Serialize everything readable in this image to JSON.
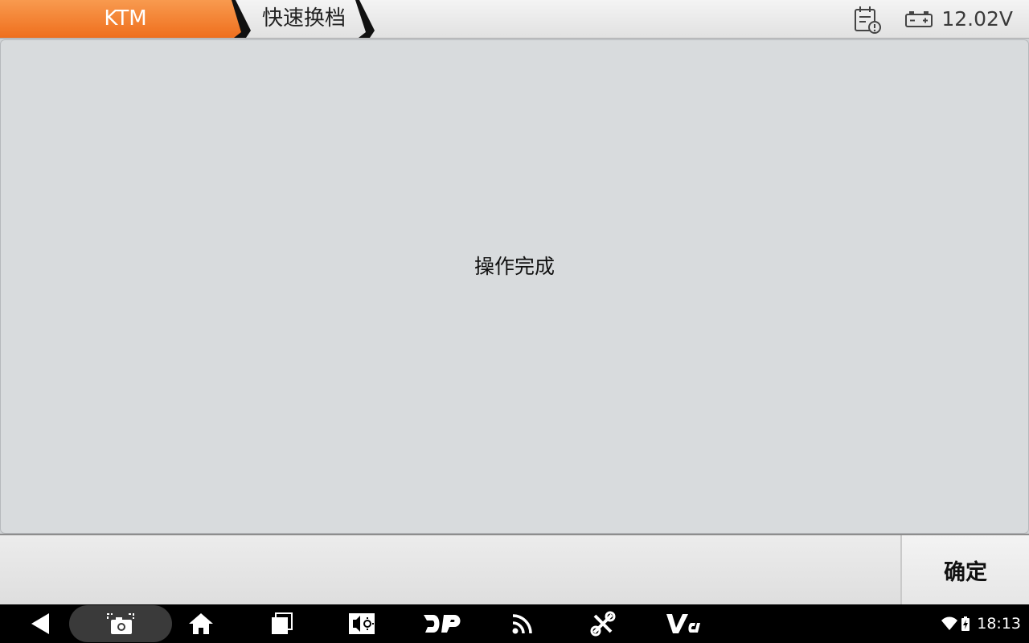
{
  "breadcrumb": {
    "items": [
      {
        "label": "KTM"
      },
      {
        "label": "快速换档"
      }
    ]
  },
  "status": {
    "voltage": "12.02V",
    "clock": "18:13"
  },
  "main": {
    "message": "操作完成"
  },
  "actions": {
    "ok_label": "确定"
  },
  "icons": {
    "diagnostic": "calendar-alert-icon",
    "battery": "car-battery-icon",
    "back": "back-icon",
    "screenshot": "screenshot-icon",
    "home": "home-icon",
    "recents": "recents-icon",
    "brightness": "display-settings-icon",
    "dp": "dp-icon",
    "signal": "signal-icon",
    "tools": "tools-icon",
    "vci": "vci-icon",
    "wifi": "wifi-icon",
    "battery_status": "battery-charging-icon"
  },
  "colors": {
    "accent": "#f37f2b",
    "content_bg": "#d8dbdd",
    "navbar_bg": "#000000"
  }
}
